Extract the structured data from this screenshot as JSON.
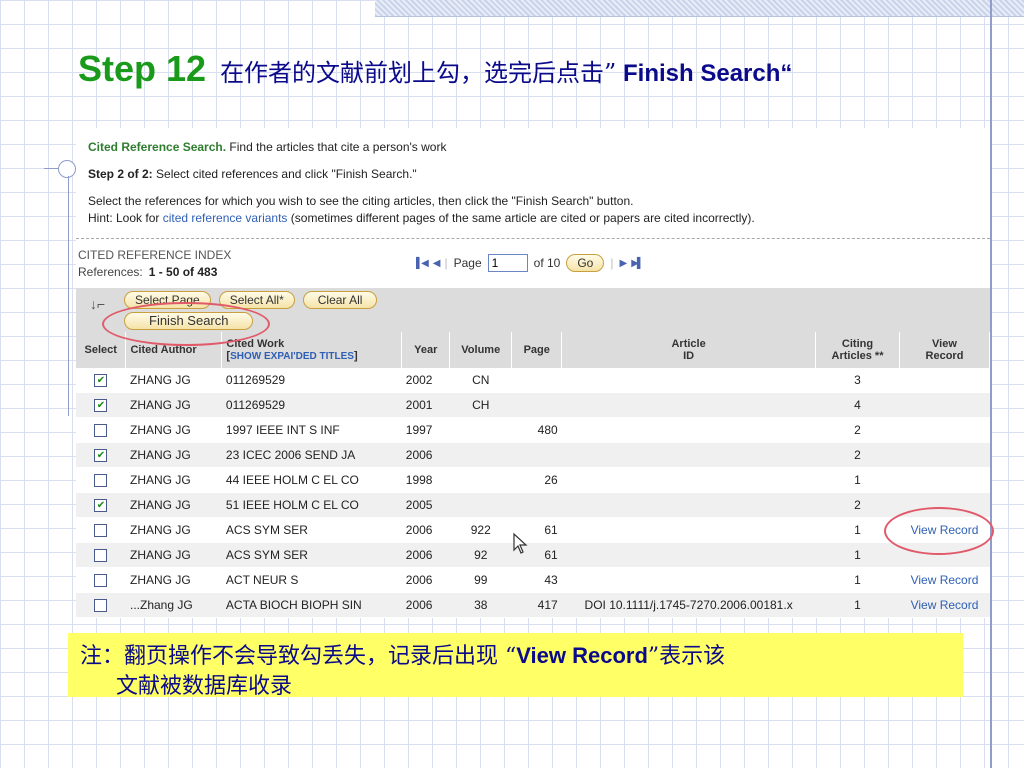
{
  "slide": {
    "step": "Step 12",
    "instruction_cn": "在作者的文献前划上勾，选完后点击”",
    "instruction_en": " Finish Search“"
  },
  "panel": {
    "intro": {
      "title_bold": "Cited Reference Search.",
      "title_rest": " Find the articles that cite a person's work",
      "step_bold": "Step 2 of 2:",
      "step_rest": " Select cited references and click \"Finish Search.\"",
      "line1": "Select the references for which you wish to see the citing articles, then click the \"Finish Search\" button.",
      "hint_prefix": "Hint: Look for ",
      "hint_link": "cited reference variants",
      "hint_suffix": " (sometimes different pages of the same article are cited or papers are cited incorrectly)."
    },
    "index": {
      "title": "CITED REFERENCE INDEX",
      "refs_label": "References:",
      "refs_value": "1 - 50 of  483"
    },
    "pager": {
      "page_label": "Page",
      "page_value": "1",
      "of_label": "of 10",
      "go_label": "Go"
    },
    "buttons": {
      "select_page": "Select Page",
      "select_all": "Select All*",
      "clear_all": "Clear All",
      "finish_search": "Finish Search"
    },
    "columns": {
      "select": "Select",
      "cited_author": "Cited Author",
      "cited_work": "Cited Work",
      "show_expanded": "SHOW EXPAI'DED TITLES",
      "year": "Year",
      "volume": "Volume",
      "page": "Page",
      "article_id_1": "Article",
      "article_id_2": "ID",
      "citing_1": "Citing",
      "citing_2": "Articles **",
      "view_1": "View",
      "view_2": "Record"
    },
    "rows": [
      {
        "checked": true,
        "author": "ZHANG JG",
        "work": "011269529",
        "year": "2002",
        "volume": "CN",
        "page": "",
        "article_id": "",
        "citing": "3",
        "view": ""
      },
      {
        "checked": true,
        "author": "ZHANG JG",
        "work": "011269529",
        "year": "2001",
        "volume": "CH",
        "page": "",
        "article_id": "",
        "citing": "4",
        "view": ""
      },
      {
        "checked": false,
        "author": "ZHANG JG",
        "work": "1997 IEEE INT S INF",
        "year": "1997",
        "volume": "",
        "page": "480",
        "article_id": "",
        "citing": "2",
        "view": ""
      },
      {
        "checked": true,
        "author": "ZHANG JG",
        "work": "23 ICEC 2006 SEND JA",
        "year": "2006",
        "volume": "",
        "page": "",
        "article_id": "",
        "citing": "2",
        "view": ""
      },
      {
        "checked": false,
        "author": "ZHANG JG",
        "work": "44 IEEE HOLM C EL CO",
        "year": "1998",
        "volume": "",
        "page": "26",
        "article_id": "",
        "citing": "1",
        "view": ""
      },
      {
        "checked": true,
        "author": "ZHANG JG",
        "work": "51 IEEE HOLM C EL CO",
        "year": "2005",
        "volume": "",
        "page": "",
        "article_id": "",
        "citing": "2",
        "view": ""
      },
      {
        "checked": false,
        "author": "ZHANG JG",
        "work": "ACS SYM SER",
        "year": "2006",
        "volume": "922",
        "page": "61",
        "article_id": "",
        "citing": "1",
        "view": "View Record"
      },
      {
        "checked": false,
        "author": "ZHANG JG",
        "work": "ACS SYM SER",
        "year": "2006",
        "volume": "92",
        "page": "61",
        "article_id": "",
        "citing": "1",
        "view": ""
      },
      {
        "checked": false,
        "author": "ZHANG JG",
        "work": "ACT NEUR S",
        "year": "2006",
        "volume": "99",
        "page": "43",
        "article_id": "",
        "citing": "1",
        "view": "View Record"
      },
      {
        "checked": false,
        "author": "...Zhang JG",
        "work": "ACTA BIOCH BIOPH SIN",
        "year": "2006",
        "volume": "38",
        "page": "417",
        "article_id": "DOI 10.1111/j.1745-7270.2006.00181.x",
        "citing": "1",
        "view": "View Record"
      }
    ]
  },
  "note": {
    "prefix": "注：翻页操作不会导致勾丢失，记录后出现 “",
    "emphasis": "View Record",
    "suffix": "”表示该",
    "line2": "文献被数据库收录"
  }
}
